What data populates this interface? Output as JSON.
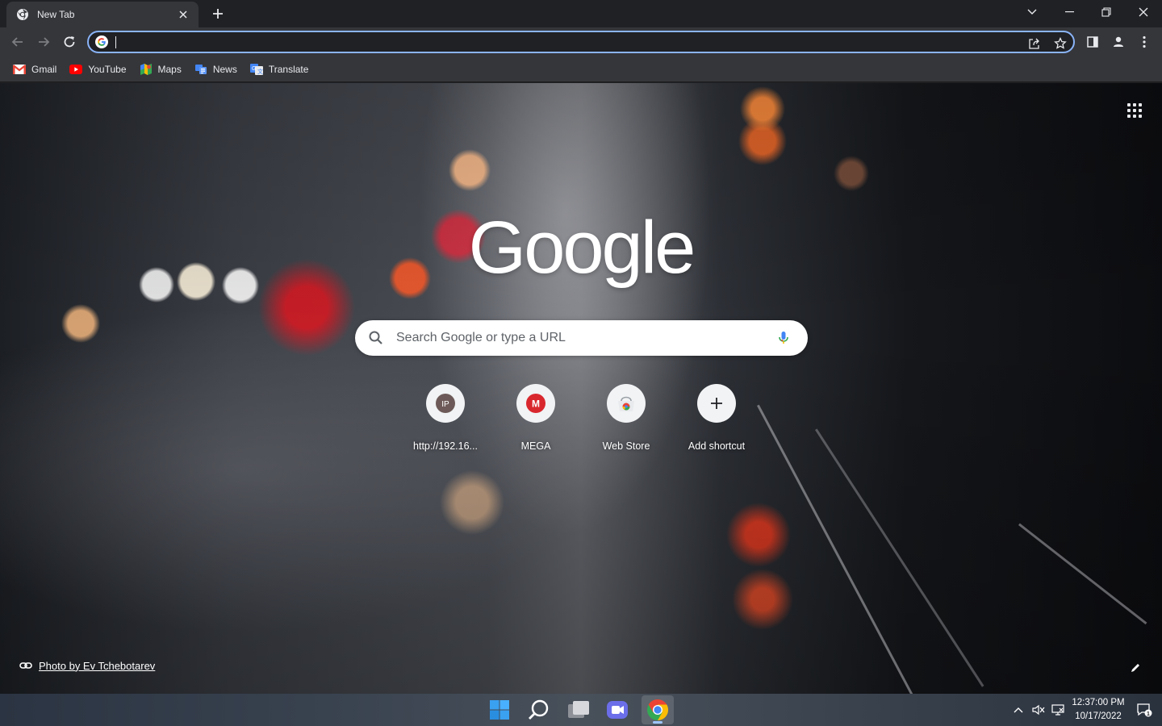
{
  "browser": {
    "tab": {
      "title": "New Tab"
    },
    "omnibox": {
      "value": "",
      "placeholder": ""
    }
  },
  "bookmarks": [
    {
      "label": "Gmail",
      "icon": "gmail-icon"
    },
    {
      "label": "YouTube",
      "icon": "youtube-icon"
    },
    {
      "label": "Maps",
      "icon": "maps-icon"
    },
    {
      "label": "News",
      "icon": "news-icon"
    },
    {
      "label": "Translate",
      "icon": "translate-icon"
    }
  ],
  "ntp": {
    "logo": "Google",
    "search": {
      "placeholder": "Search Google or type a URL"
    },
    "shortcuts": [
      {
        "label": "http://192.16...",
        "icon_text": "IP"
      },
      {
        "label": "MEGA",
        "icon_text": "M"
      },
      {
        "label": "Web Store",
        "icon": "web-store-icon"
      },
      {
        "label": "Add shortcut",
        "icon": "plus-icon"
      }
    ],
    "attribution": "Photo by Ev Tchebotarev"
  },
  "taskbar": {
    "apps": [
      "start",
      "search",
      "task-view",
      "teams",
      "chrome"
    ],
    "active_app": "chrome",
    "time": "12:37:00 PM",
    "date": "10/17/2022",
    "notification_count": "1"
  },
  "colors": {
    "chrome_dark": "#202124",
    "toolbar": "#35363a",
    "accent": "#8ab4f8",
    "google_blue": "#4285f4",
    "google_red": "#ea4335",
    "google_yellow": "#fbbc05",
    "google_green": "#34a853",
    "mega_red": "#d9272e"
  }
}
